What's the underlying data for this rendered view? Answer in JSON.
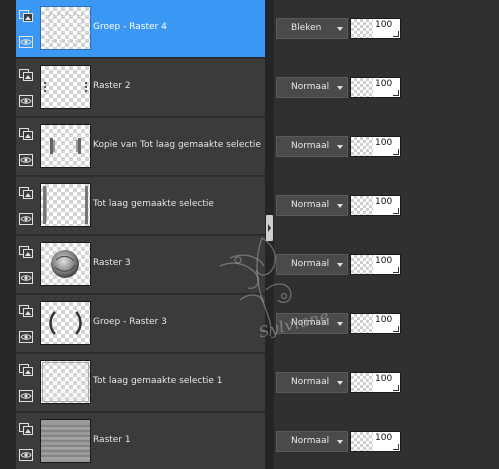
{
  "layers_panel": {
    "layers": [
      {
        "name": "Groep - Raster 4",
        "blend_mode": "Bleken",
        "opacity": "100",
        "selected": true,
        "thumb": "group-thumbnail"
      },
      {
        "name": "Raster 2",
        "blend_mode": "Normaal",
        "opacity": "100",
        "selected": false,
        "thumb": "dots-thumbnail"
      },
      {
        "name": "Kopie van Tot laag gemaakte selectie",
        "blend_mode": "Normaal",
        "opacity": "100",
        "selected": false,
        "thumb": "bars-thumbnail"
      },
      {
        "name": "Tot laag gemaakte selectie",
        "blend_mode": "Normaal",
        "opacity": "100",
        "selected": false,
        "thumb": "frame-thumbnail"
      },
      {
        "name": "Raster 3",
        "blend_mode": "Normaal",
        "opacity": "100",
        "selected": false,
        "thumb": "circle-thumbnail"
      },
      {
        "name": "Groep - Raster 3",
        "blend_mode": "Normaal",
        "opacity": "100",
        "selected": false,
        "thumb": "brackets-thumbnail"
      },
      {
        "name": "Tot laag gemaakte selectie 1",
        "blend_mode": "Normaal",
        "opacity": "100",
        "selected": false,
        "thumb": "border-thumbnail"
      },
      {
        "name": "Raster 1",
        "blend_mode": "Normaal",
        "opacity": "100",
        "selected": false,
        "thumb": "texture-thumbnail"
      }
    ],
    "icons": {
      "layer_type": "layer-type-icon",
      "visibility": "eye-icon",
      "dropdown": "chevron-down-icon",
      "collapse": "collapse-handle-icon"
    },
    "colors": {
      "selected_row": "#3a97f4",
      "row": "#3b3b3b",
      "panel": "#2d2d2d"
    }
  },
  "watermark": {
    "text": "Sylviane"
  }
}
